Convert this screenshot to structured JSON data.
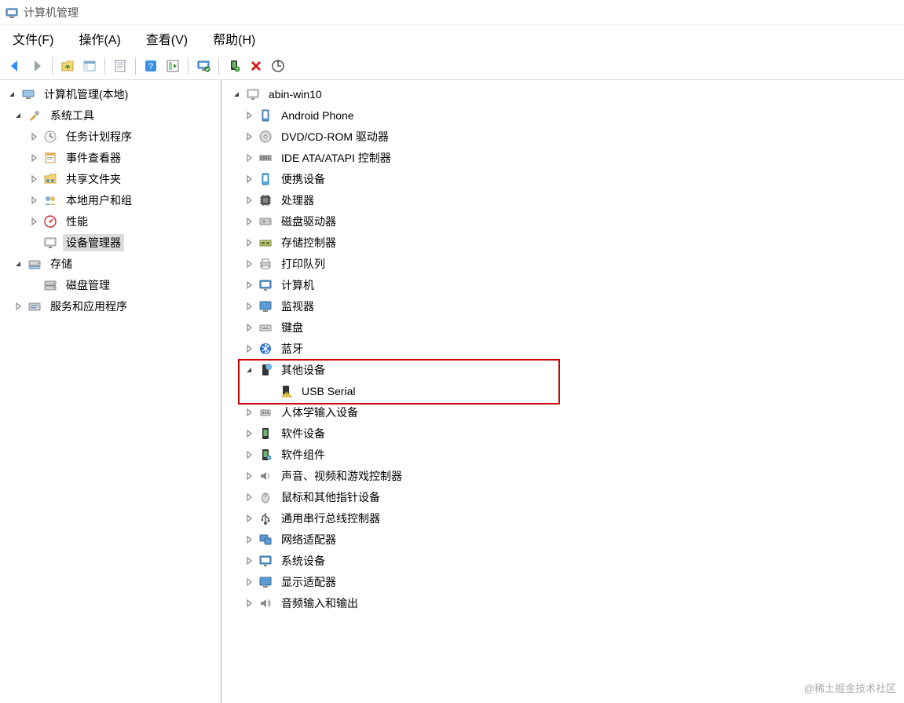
{
  "window": {
    "title": "计算机管理"
  },
  "menu": {
    "file": "文件(F)",
    "action": "操作(A)",
    "view": "查看(V)",
    "help": "帮助(H)"
  },
  "toolbar": {
    "back": "后退",
    "forward": "前进",
    "up_folder": "上级",
    "show_pane": "面板",
    "properties": "属性",
    "help": "帮助",
    "run": "运行",
    "monitor": "显示",
    "device": "设备",
    "delete": "删除",
    "scan": "扫描"
  },
  "left_tree": {
    "root": "计算机管理(本地)",
    "system_tools": "系统工具",
    "task_scheduler": "任务计划程序",
    "event_viewer": "事件查看器",
    "shared_folders": "共享文件夹",
    "local_users_groups": "本地用户和组",
    "performance": "性能",
    "device_manager": "设备管理器",
    "storage": "存储",
    "disk_management": "磁盘管理",
    "services_apps": "服务和应用程序"
  },
  "right_tree": {
    "computer": "abin-win10",
    "android_phone": "Android Phone",
    "dvd_cdrom": "DVD/CD-ROM 驱动器",
    "ide_ata": "IDE ATA/ATAPI 控制器",
    "portable_devices": "便携设备",
    "processors": "处理器",
    "disk_drives": "磁盘驱动器",
    "storage_controllers": "存储控制器",
    "print_queues": "打印队列",
    "computers": "计算机",
    "monitors": "监视器",
    "keyboards": "键盘",
    "bluetooth": "蓝牙",
    "other_devices": "其他设备",
    "usb_serial": "USB Serial",
    "hid": "人体学输入设备",
    "software_devices": "软件设备",
    "software_components": "软件组件",
    "sound": "声音、视频和游戏控制器",
    "mice": "鼠标和其他指针设备",
    "usb_controllers": "通用串行总线控制器",
    "network_adapters": "网络适配器",
    "system_devices": "系统设备",
    "display_adapters": "显示适配器",
    "audio_io": "音频输入和输出"
  },
  "watermark": "@稀土掘金技术社区"
}
